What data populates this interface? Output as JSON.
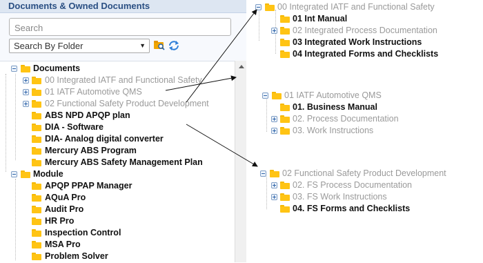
{
  "panel": {
    "title": "Documents & Owned Documents",
    "search_placeholder": "Search",
    "folder_select": "Search By Folder"
  },
  "tree": {
    "documents": "Documents",
    "d1": "00 Integrated IATF and Functional Safety",
    "d2": "01 IATF Automotive QMS",
    "d3": "02 Functional Safety Product Development",
    "d4": "ABS NPD APQP plan",
    "d5": "DIA - Software",
    "d6": "DIA- Analog digital converter",
    "d7": "Mercury ABS Program",
    "d8": "Mercury ABS Safety Management Plan",
    "module": "Module",
    "m1": "APQP PPAP Manager",
    "m2": "AQuA Pro",
    "m3": "Audit Pro",
    "m4": "HR Pro",
    "m5": "Inspection Control",
    "m6": "MSA Pro",
    "m7": "Problem Solver"
  },
  "group_iatf_fs": {
    "root": "00 Integrated IATF and Functional Safety",
    "c1": "01 Int Manual",
    "c2": "02 Integrated Process Documentation",
    "c3": "03 Integrated Work Instructions",
    "c4": "04 Integrated Forms and Checklists"
  },
  "group_iatf_qms": {
    "root": "01 IATF Automotive QMS",
    "c1": "01. Business Manual",
    "c2": "02. Process Documentation",
    "c3": "03. Work Instructions"
  },
  "group_fs": {
    "root": "02 Functional Safety Product Development",
    "c1": "02. FS Process Documentation",
    "c2": "03. FS Work Instructions",
    "c3": "04. FS Forms and Checklists"
  }
}
